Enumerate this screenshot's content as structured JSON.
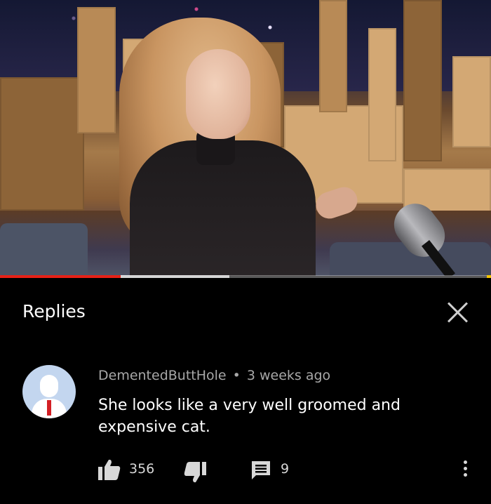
{
  "video": {
    "progress_played_fraction": 0.245,
    "progress_buffered_fraction": 0.467,
    "accent_color": "#e62117"
  },
  "panel": {
    "title": "Replies",
    "close_icon": "close-icon"
  },
  "comment": {
    "author": "DementedButtHole",
    "separator": "•",
    "time": "3 weeks ago",
    "text": "She looks like a very well groomed and expensive cat.",
    "avatar_icon": "default-avatar-icon",
    "likes": "356",
    "replies": "9",
    "icons": {
      "like": "thumbs-up-icon",
      "dislike": "thumbs-down-icon",
      "reply": "reply-icon",
      "more": "more-vertical-icon"
    }
  }
}
